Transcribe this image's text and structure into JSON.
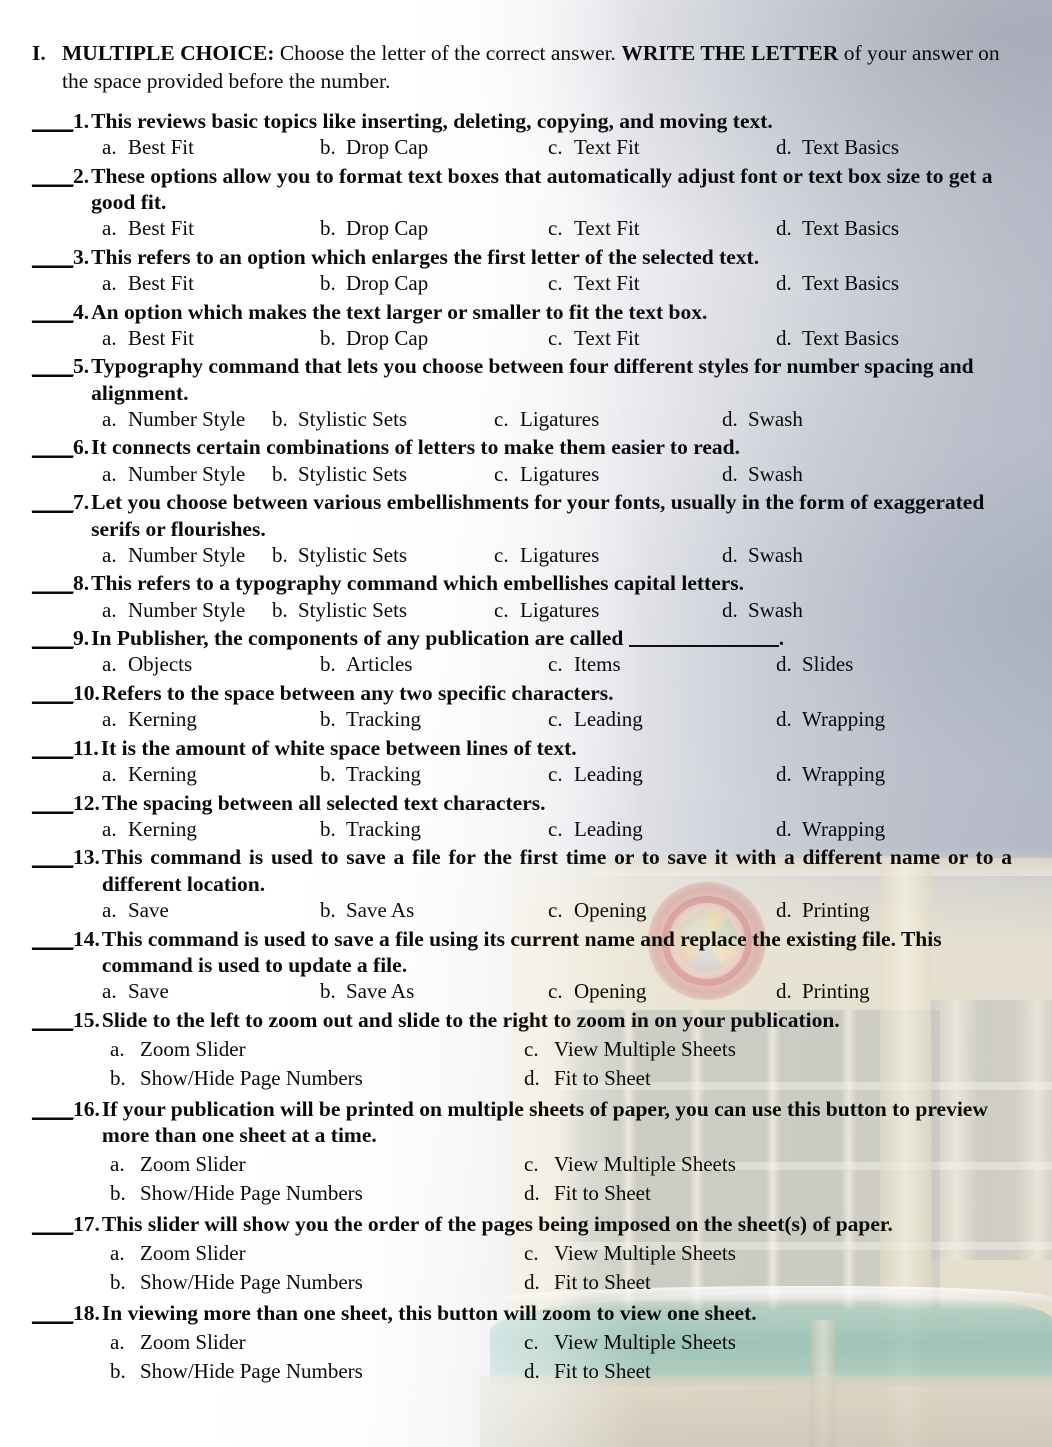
{
  "section": {
    "roman": "I.",
    "title": "MULTIPLE CHOICE:",
    "instruction_part1": "Choose the letter of the correct answer.",
    "instruction_emphasis": "WRITE THE LETTER",
    "instruction_part2": "of your answer on the space provided before the number."
  },
  "answer_blank": "____",
  "questions": [
    {
      "number": "1.",
      "text": "This reviews basic topics like inserting, deleting, copying, and moving text.",
      "layout": "inline-4",
      "tabset": "setA",
      "options": [
        {
          "letter": "a.",
          "value": "Best Fit"
        },
        {
          "letter": "b.",
          "value": "Drop Cap"
        },
        {
          "letter": "c.",
          "value": "Text Fit"
        },
        {
          "letter": "d.",
          "value": "Text Basics"
        }
      ]
    },
    {
      "number": "2.",
      "text": "These options allow you to format text boxes that automatically adjust font or text box size to get a good fit.",
      "layout": "inline-4",
      "tabset": "setA",
      "options": [
        {
          "letter": "a.",
          "value": "Best Fit"
        },
        {
          "letter": "b.",
          "value": "Drop Cap"
        },
        {
          "letter": "c.",
          "value": "Text Fit"
        },
        {
          "letter": "d.",
          "value": "Text Basics"
        }
      ]
    },
    {
      "number": "3.",
      "text": "This refers to an option which enlarges the first letter of the selected text.",
      "layout": "inline-4",
      "tabset": "setA",
      "options": [
        {
          "letter": "a.",
          "value": "Best Fit"
        },
        {
          "letter": "b.",
          "value": "Drop Cap"
        },
        {
          "letter": "c.",
          "value": "Text Fit"
        },
        {
          "letter": "d.",
          "value": "Text Basics"
        }
      ]
    },
    {
      "number": "4.",
      "text": "An option which makes the text larger or smaller to fit the text box.",
      "layout": "inline-4",
      "tabset": "setA",
      "options": [
        {
          "letter": "a.",
          "value": "Best Fit"
        },
        {
          "letter": "b.",
          "value": "Drop Cap"
        },
        {
          "letter": "c.",
          "value": "Text Fit"
        },
        {
          "letter": "d.",
          "value": "Text Basics"
        }
      ]
    },
    {
      "number": "5.",
      "text": "Typography command that lets you choose between four different styles for number spacing and alignment.",
      "layout": "inline-4",
      "tabset": "setB",
      "options": [
        {
          "letter": "a.",
          "value": "Number Style"
        },
        {
          "letter": "b.",
          "value": "Stylistic Sets"
        },
        {
          "letter": "c.",
          "value": "Ligatures"
        },
        {
          "letter": "d.",
          "value": "Swash"
        }
      ]
    },
    {
      "number": "6.",
      "text": "It connects certain combinations of letters to make them easier to read.",
      "layout": "inline-4",
      "tabset": "setB",
      "options": [
        {
          "letter": "a.",
          "value": "Number Style"
        },
        {
          "letter": "b.",
          "value": "Stylistic Sets"
        },
        {
          "letter": "c.",
          "value": "Ligatures"
        },
        {
          "letter": "d.",
          "value": "Swash"
        }
      ]
    },
    {
      "number": "7.",
      "text": "Let you choose between various embellishments for your fonts, usually in the form of exaggerated serifs or flourishes.",
      "layout": "inline-4",
      "tabset": "setB",
      "options": [
        {
          "letter": "a.",
          "value": "Number Style"
        },
        {
          "letter": "b.",
          "value": "Stylistic Sets"
        },
        {
          "letter": "c.",
          "value": "Ligatures"
        },
        {
          "letter": "d.",
          "value": "Swash"
        }
      ]
    },
    {
      "number": "8.",
      "text": "This refers to a typography command which embellishes capital letters.",
      "layout": "inline-4",
      "tabset": "setB",
      "options": [
        {
          "letter": "a.",
          "value": "Number Style"
        },
        {
          "letter": "b.",
          "value": "Stylistic Sets"
        },
        {
          "letter": "c.",
          "value": "Ligatures"
        },
        {
          "letter": "d.",
          "value": "Swash"
        }
      ]
    },
    {
      "number": "9.",
      "text_before_blank": "In Publisher, the components of any publication are called ",
      "text_after_blank": ".",
      "has_fill_blank": true,
      "layout": "inline-4",
      "tabset": "setC",
      "options": [
        {
          "letter": "a.",
          "value": "Objects"
        },
        {
          "letter": "b.",
          "value": "Articles"
        },
        {
          "letter": "c.",
          "value": "Items"
        },
        {
          "letter": "d.",
          "value": "Slides"
        }
      ]
    },
    {
      "number": "10.",
      "text": "Refers to the space between any two specific characters.",
      "layout": "inline-4",
      "tabset": "setC",
      "options": [
        {
          "letter": "a.",
          "value": "Kerning"
        },
        {
          "letter": "b.",
          "value": "Tracking"
        },
        {
          "letter": "c.",
          "value": "Leading"
        },
        {
          "letter": "d.",
          "value": "Wrapping"
        }
      ]
    },
    {
      "number": "11.",
      "text": "It is the amount of white space between lines of text.",
      "layout": "inline-4",
      "tabset": "setC",
      "options": [
        {
          "letter": "a.",
          "value": "Kerning"
        },
        {
          "letter": "b.",
          "value": "Tracking"
        },
        {
          "letter": "c.",
          "value": "Leading"
        },
        {
          "letter": "d.",
          "value": "Wrapping"
        }
      ]
    },
    {
      "number": "12.",
      "text": "The spacing between all selected text characters.",
      "layout": "inline-4",
      "tabset": "setC",
      "options": [
        {
          "letter": "a.",
          "value": "Kerning"
        },
        {
          "letter": "b.",
          "value": "Tracking"
        },
        {
          "letter": "c.",
          "value": "Leading"
        },
        {
          "letter": "d.",
          "value": "Wrapping"
        }
      ]
    },
    {
      "number": "13.",
      "text": "This command is used to save a file for the first time or to save it with a different name or to a different location.",
      "justify": true,
      "layout": "inline-4",
      "tabset": "setC",
      "options": [
        {
          "letter": "a.",
          "value": "Save"
        },
        {
          "letter": "b.",
          "value": "Save As"
        },
        {
          "letter": "c.",
          "value": "Opening"
        },
        {
          "letter": "d.",
          "value": "Printing"
        }
      ]
    },
    {
      "number": "14.",
      "text": "This command is used to save a file using its current name and replace the existing file. This command is used to update a file.",
      "layout": "inline-4",
      "tabset": "setC",
      "options": [
        {
          "letter": "a.",
          "value": "Save"
        },
        {
          "letter": "b.",
          "value": "Save As"
        },
        {
          "letter": "c.",
          "value": "Opening"
        },
        {
          "letter": "d.",
          "value": "Printing"
        }
      ]
    },
    {
      "number": "15.",
      "text": "Slide to the left to zoom out and slide to the right to zoom in on your publication.",
      "justify": true,
      "layout": "two-column",
      "options": [
        {
          "letter": "a.",
          "value": "Zoom Slider"
        },
        {
          "letter": "c.",
          "value": "View Multiple Sheets"
        },
        {
          "letter": "b.",
          "value": "Show/Hide Page Numbers"
        },
        {
          "letter": "d.",
          "value": "Fit to Sheet"
        }
      ]
    },
    {
      "number": "16.",
      "text": "If your publication will be printed on multiple sheets of paper, you can use this button to preview more than one sheet at a time.",
      "layout": "two-column",
      "options": [
        {
          "letter": "a.",
          "value": "Zoom Slider"
        },
        {
          "letter": "c.",
          "value": "View Multiple Sheets"
        },
        {
          "letter": "b.",
          "value": "Show/Hide Page Numbers"
        },
        {
          "letter": "d.",
          "value": "Fit to Sheet"
        }
      ]
    },
    {
      "number": "17.",
      "text": "This slider will show you the order of the pages being imposed on the sheet(s) of paper.",
      "layout": "two-column",
      "options": [
        {
          "letter": "a.",
          "value": "Zoom Slider"
        },
        {
          "letter": "c.",
          "value": "View Multiple Sheets"
        },
        {
          "letter": "b.",
          "value": "Show/Hide Page Numbers"
        },
        {
          "letter": "d.",
          "value": "Fit to Sheet"
        }
      ]
    },
    {
      "number": "18.",
      "text": "In viewing more than one sheet, this button will zoom to view one sheet.",
      "layout": "two-column",
      "options": [
        {
          "letter": "a.",
          "value": "Zoom Slider"
        },
        {
          "letter": "c.",
          "value": "View Multiple Sheets"
        },
        {
          "letter": "b.",
          "value": "Show/Hide Page Numbers"
        },
        {
          "letter": "d.",
          "value": "Fit to Sheet"
        }
      ]
    }
  ],
  "colors": {
    "text": "#0a0a0a",
    "paper": "#fbfbfb",
    "sky": "#aeb3c1",
    "building": "#ece4ce",
    "awning": "#7ab6ac",
    "seal": "#c6686c"
  }
}
